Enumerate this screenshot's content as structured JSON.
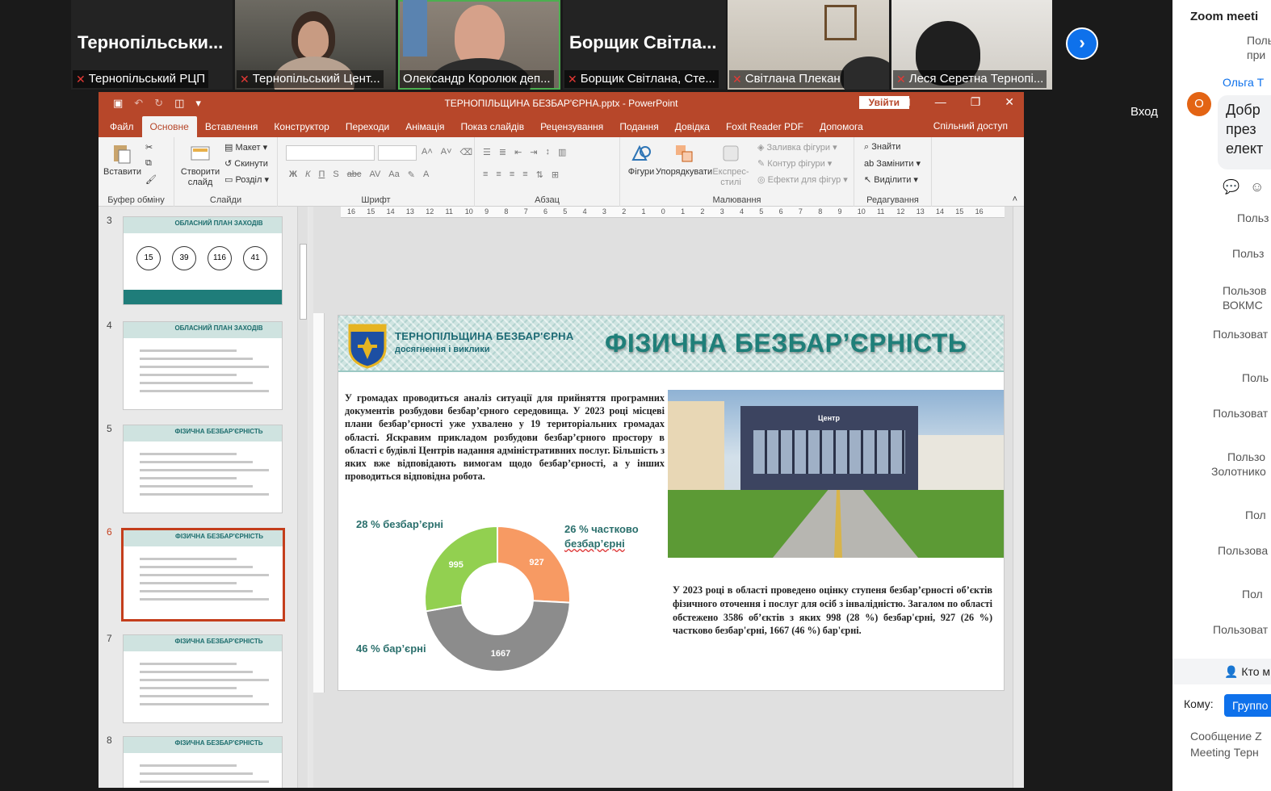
{
  "video_strip": {
    "tiles": [
      {
        "big_name": "Тернопільськи...",
        "caption": "Тернопільський РЦП",
        "muted": true
      },
      {
        "big_name": "",
        "caption": "Тернопільський Цент...",
        "muted": true
      },
      {
        "big_name": "",
        "caption": "Олександр Королюк деп...",
        "muted": false
      },
      {
        "big_name": "Борщик  Світла...",
        "caption": "Борщик Світлана, Сте...",
        "muted": true
      },
      {
        "big_name": "",
        "caption": "Світлана Плекан",
        "muted": true
      },
      {
        "big_name": "",
        "caption": "Леся Серетна Тернопі...",
        "muted": true
      }
    ],
    "next_icon": "chevron-right-icon"
  },
  "login_label": "Вход",
  "ppt": {
    "doc_title": "ТЕРНОПІЛЬЩИНА БЕЗБАР'ЄРНА.pptx  -  PowerPoint",
    "sign_in": "Увійти",
    "tabs": [
      "Файл",
      "Основне",
      "Вставлення",
      "Конструктор",
      "Переходи",
      "Анімація",
      "Показ слайдів",
      "Рецензування",
      "Подання",
      "Довідка",
      "Foxit Reader PDF",
      "Допомога"
    ],
    "selected_tab": "Основне",
    "share": "Спільний доступ",
    "ribbon": {
      "clipboard": {
        "label": "Буфер обміну",
        "paste": "Вставити"
      },
      "slides": {
        "label": "Слайди",
        "new_slide": "Створити",
        "new_slide2": "слайд",
        "layout": "Макет",
        "reset": "Скинути",
        "section": "Розділ"
      },
      "font": {
        "label": "Шрифт"
      },
      "paragraph": {
        "label": "Абзац"
      },
      "drawing": {
        "label": "Малювання",
        "shapes": "Фігури",
        "arrange": "Упорядкувати",
        "quick_styles1": "Експрес-",
        "quick_styles2": "стилі",
        "fill": "Заливка фігури",
        "outline": "Контур фігури",
        "effects": "Ефекти для фігур"
      },
      "editing": {
        "label": "Редагування",
        "find": "Знайти",
        "replace": "Замінити",
        "select": "Виділити"
      }
    },
    "thumbnails": [
      {
        "num": "3",
        "title": "ОБЛАСНИЙ ПЛАН ЗАХОДІВ",
        "circles": [
          "15",
          "39",
          "116",
          "41"
        ]
      },
      {
        "num": "4",
        "title": "ОБЛАСНИЙ ПЛАН ЗАХОДІВ"
      },
      {
        "num": "5",
        "title": "ФІЗИЧНА БЕЗБАР'ЄРНІСТЬ"
      },
      {
        "num": "6",
        "title": "ФІЗИЧНА БЕЗБАР'ЄРНІСТЬ",
        "selected": true
      },
      {
        "num": "7",
        "title": "ФІЗИЧНА БЕЗБАР'ЄРНІСТЬ"
      },
      {
        "num": "8",
        "title": "ФІЗИЧНА БЕЗБАР'ЄРНІСТЬ"
      }
    ],
    "ruler_marks": [
      "16",
      "15",
      "14",
      "13",
      "12",
      "11",
      "10",
      "9",
      "8",
      "7",
      "6",
      "5",
      "4",
      "3",
      "2",
      "1",
      "0",
      "1",
      "2",
      "3",
      "4",
      "5",
      "6",
      "7",
      "8",
      "9",
      "10",
      "11",
      "12",
      "13",
      "14",
      "15",
      "16"
    ],
    "slide": {
      "brand_line1": "ТЕРНОПІЛЬЩИНА БЕЗБАР'ЄРНА",
      "brand_line2": "досягнення і виклики",
      "title": "ФІЗИЧНА БЕЗБАР’ЄРНІСТЬ",
      "paragraph1": "У громадах проводиться аналіз ситуації для прийняття програмних документів розбудови безбар’єрного середовища. У 2023 році місцеві плани безбар’єрності уже ухвалено у 19 територіальних громадах області. Яскравим прикладом розбудови безбар’єрного простору в області є будівлі Центрів надання адміністративних послуг. Більшість з яких вже відповідають вимогам щодо безбар’єрності, а у інших проводиться відповідна робота.",
      "paragraph2": "У 2023 році в області проведено оцінку ступеня безбар’єрності об’єктів фізичного оточення і послуг для осіб з інвалідністю. Загалом по області обстежено 3586 об’єктів з яких 998 (28 %) безбар'єрні, 927 (26 %) частково безбар'єрні, 1667 (46 %) бар'єрні.",
      "photo_sign": "Центр"
    }
  },
  "chart_data": {
    "type": "pie",
    "donut": true,
    "categories": [
      "26 % частково безбар’єрні",
      "46 % бар’єрні",
      "28 % безбар’єрні"
    ],
    "values": [
      927,
      1667,
      995
    ],
    "colors": [
      "#f79a63",
      "#8c8c8c",
      "#92d050"
    ],
    "label_lines": [
      [
        "26 % частково",
        "безбар’єрні"
      ],
      [
        "46 % бар’єрні"
      ],
      [
        "28 % безбар’єрні"
      ]
    ]
  },
  "chat": {
    "title": "Zoom meeti",
    "sender": "Ольга Т",
    "avatar_letter": "О",
    "bubble": [
      "Добр",
      "през",
      "елект"
    ],
    "entries": [
      "Поль",
      "при",
      "Польз",
      "Польз",
      "Пользов",
      "ВОКМС",
      "Пользоват",
      "Поль",
      "Пользоват",
      "Пользо",
      "Золотнико",
      "Пол",
      "Пользова",
      "Пол",
      "Пользоват"
    ],
    "who_label": "Кто м",
    "to_label": "Кому:",
    "to_button": "Группо",
    "compose1": "Сообщение Z",
    "compose2": "Meeting Терн"
  }
}
